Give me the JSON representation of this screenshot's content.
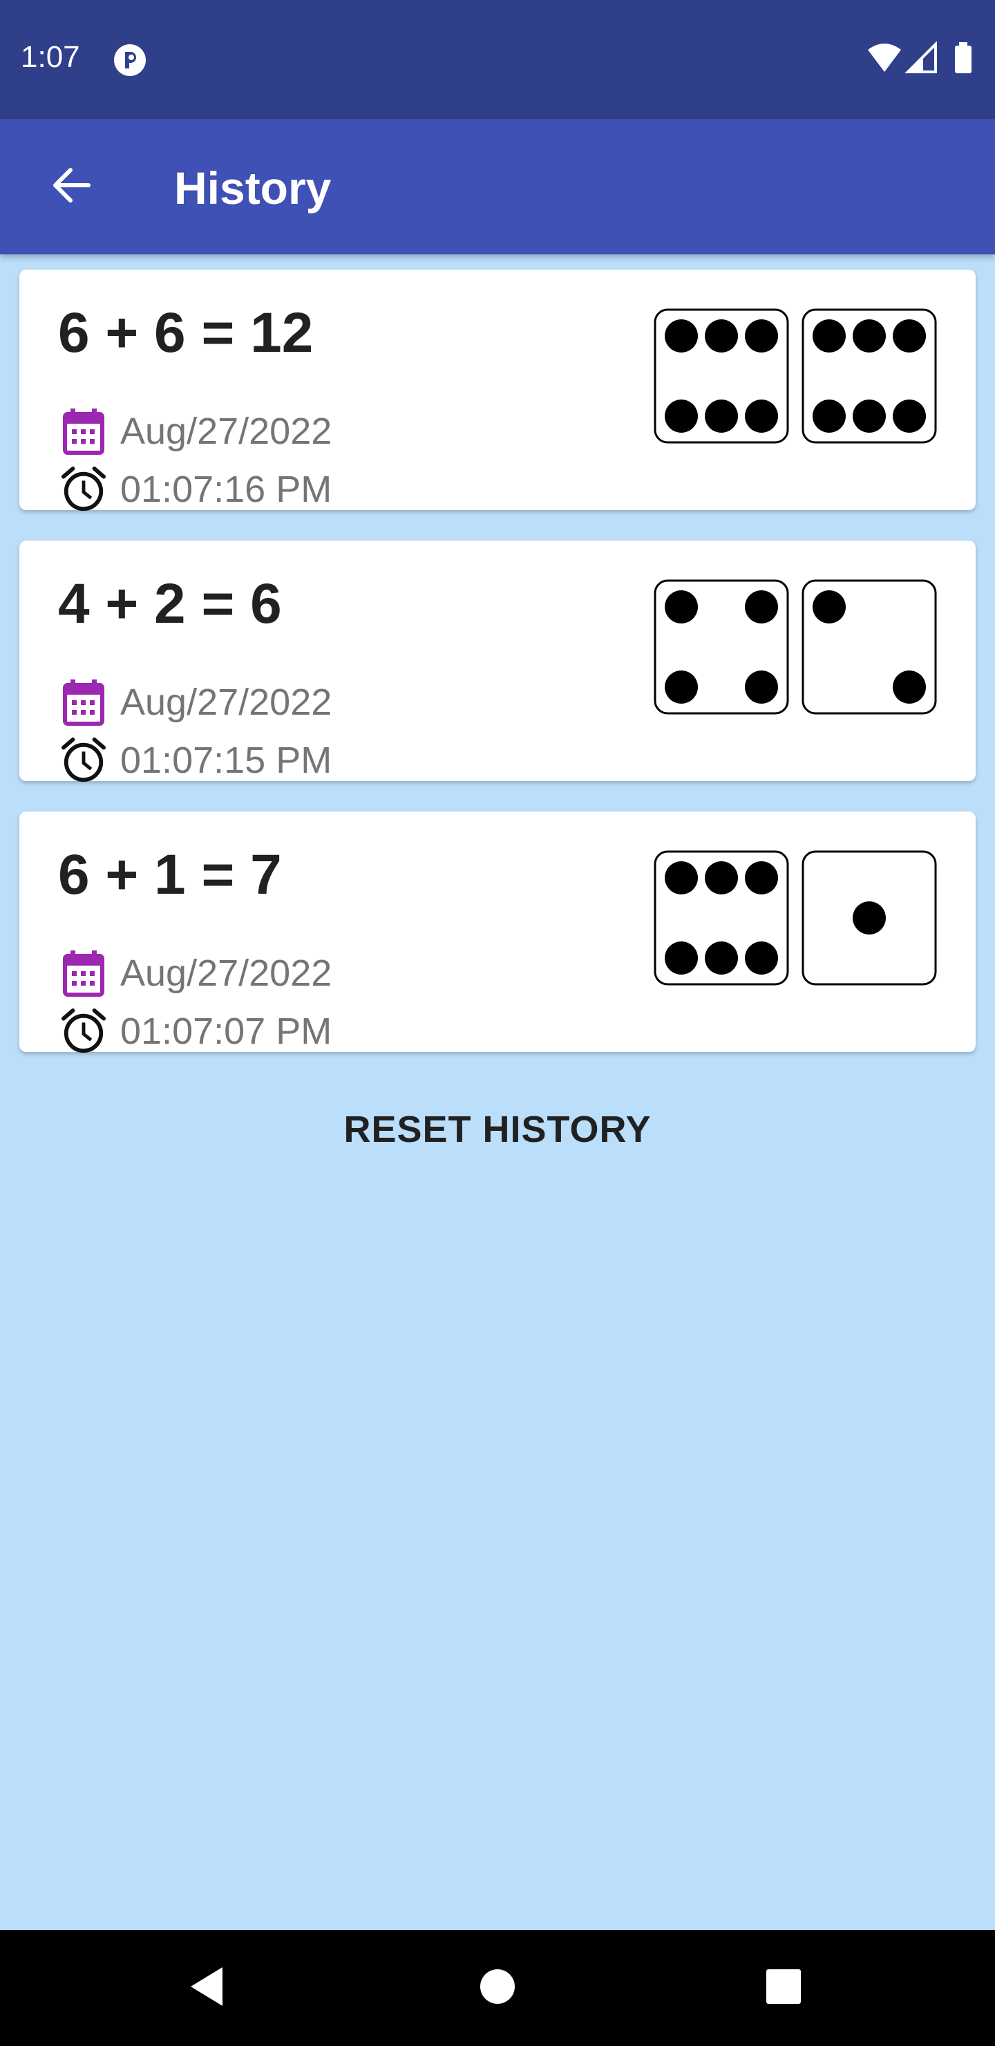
{
  "status_bar": {
    "time": "1:07",
    "app_icon": "circle-logo-icon",
    "wifi_icon": "wifi-icon",
    "signal_icon": "signal-icon",
    "battery_icon": "battery-icon"
  },
  "app_bar": {
    "title": "History",
    "back_icon": "arrow-left-icon"
  },
  "history": [
    {
      "equation": "6 + 6 = 12",
      "date": "Aug/27/2022",
      "time": "01:07:16 PM",
      "die1": 6,
      "die2": 6
    },
    {
      "equation": "4 + 2 = 6",
      "date": "Aug/27/2022",
      "time": "01:07:15 PM",
      "die1": 4,
      "die2": 2
    },
    {
      "equation": "6 + 1 = 7",
      "date": "Aug/27/2022",
      "time": "01:07:07 PM",
      "die1": 6,
      "die2": 1
    }
  ],
  "reset_label": "RESET HISTORY",
  "colors": {
    "status_bar": "#303f8a",
    "app_bar": "#3f51b5",
    "background": "#bbdefb",
    "calendar_icon": "#9c27b0"
  },
  "nav_bar": {
    "back": "nav-back-icon",
    "home": "nav-home-icon",
    "recents": "nav-recents-icon"
  }
}
